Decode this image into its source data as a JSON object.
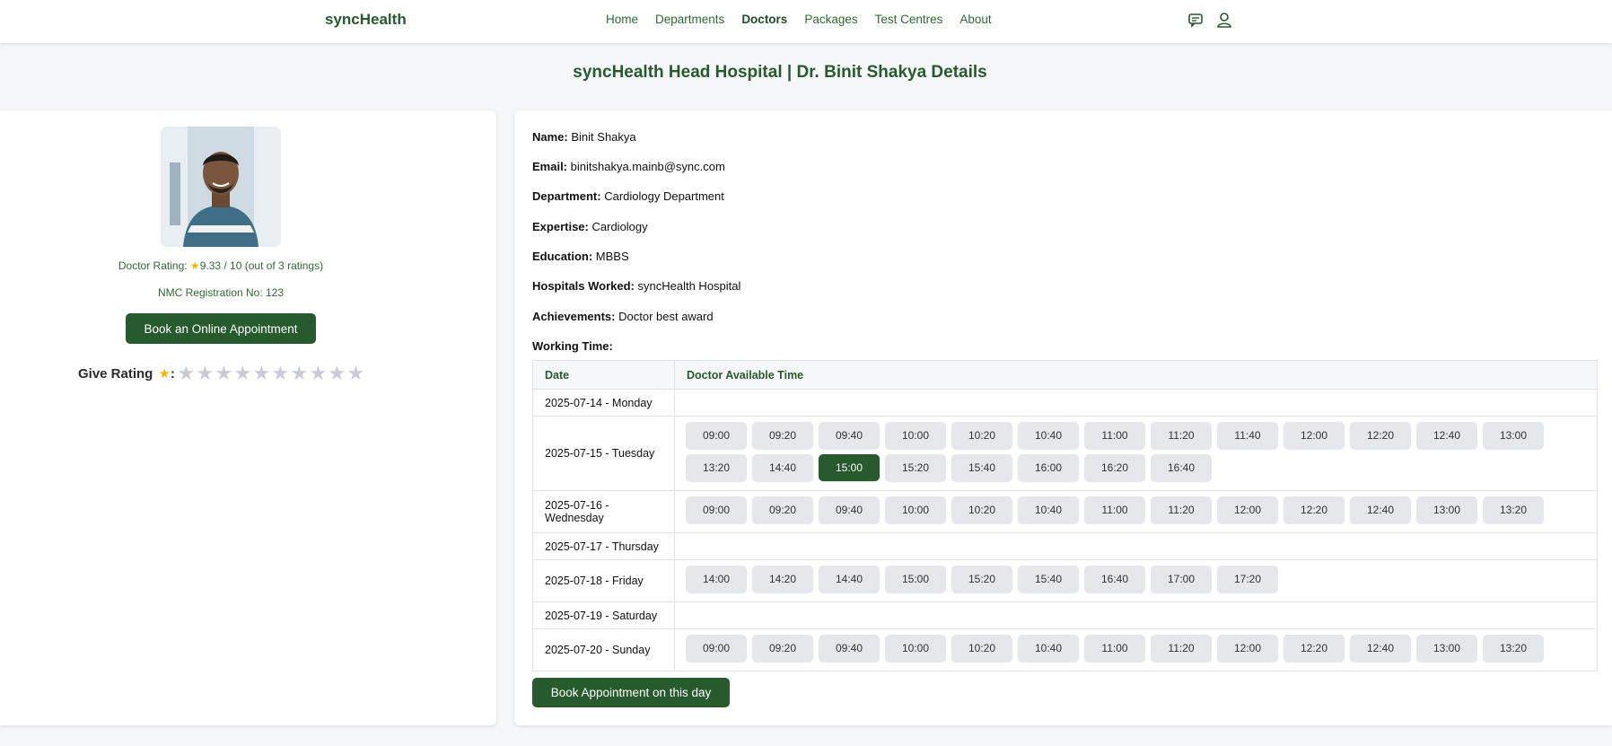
{
  "header": {
    "brand": "syncHealth",
    "nav": [
      "Home",
      "Departments",
      "Doctors",
      "Packages",
      "Test Centres",
      "About"
    ],
    "active_nav": "Doctors",
    "icons": [
      "chat-icon",
      "user-icon"
    ]
  },
  "page_title": "syncHealth Head Hospital | Dr. Binit Shakya Details",
  "profile": {
    "rating_label": "Doctor Rating:",
    "rating_value": "9.33 / 10 (out of 3 ratings)",
    "nmc": "NMC Registration No: 123",
    "book_online": "Book an Online Appointment",
    "give_rating_label": "Give Rating",
    "give_rating_colon": ":"
  },
  "details": {
    "name_label": "Name:",
    "name": "Binit Shakya",
    "email_label": "Email:",
    "email": "binitshakya.mainb@sync.com",
    "department_label": "Department:",
    "department": "Cardiology Department",
    "expertise_label": "Expertise:",
    "expertise": "Cardiology",
    "education_label": "Education:",
    "education": "MBBS",
    "hospitals_label": "Hospitals Worked:",
    "hospitals": "syncHealth Hospital",
    "achievements_label": "Achievements:",
    "achievements": "Doctor best award",
    "working_time_label": "Working Time:"
  },
  "schedule": {
    "columns": [
      "Date",
      "Doctor Available Time"
    ],
    "rows": [
      {
        "date": "2025-07-14 - Monday",
        "slots": []
      },
      {
        "date": "2025-07-15 - Tuesday",
        "slots": [
          "09:00",
          "09:20",
          "09:40",
          "10:00",
          "10:20",
          "10:40",
          "11:00",
          "11:20",
          "11:40",
          "12:00",
          "12:20",
          "12:40",
          "13:00",
          "13:20",
          "14:40",
          "15:00",
          "15:20",
          "15:40",
          "16:00",
          "16:20",
          "16:40"
        ],
        "selected": "15:00"
      },
      {
        "date": "2025-07-16 - Wednesday",
        "slots": [
          "09:00",
          "09:20",
          "09:40",
          "10:00",
          "10:20",
          "10:40",
          "11:00",
          "11:20",
          "12:00",
          "12:20",
          "12:40",
          "13:00",
          "13:20"
        ]
      },
      {
        "date": "2025-07-17 - Thursday",
        "slots": []
      },
      {
        "date": "2025-07-18 - Friday",
        "slots": [
          "14:00",
          "14:20",
          "14:40",
          "15:00",
          "15:20",
          "15:40",
          "16:40",
          "17:00",
          "17:20"
        ]
      },
      {
        "date": "2025-07-19 - Saturday",
        "slots": []
      },
      {
        "date": "2025-07-20 - Sunday",
        "slots": [
          "09:00",
          "09:20",
          "09:40",
          "10:00",
          "10:20",
          "10:40",
          "11:00",
          "11:20",
          "12:00",
          "12:20",
          "12:40",
          "13:00",
          "13:20"
        ]
      }
    ]
  },
  "book_day": "Book Appointment on this day",
  "colors": {
    "brand_green": "#275a2c",
    "slot_bg": "#e5e7ea",
    "star_gold": "#f2b705",
    "star_empty": "#c9cdd3"
  }
}
